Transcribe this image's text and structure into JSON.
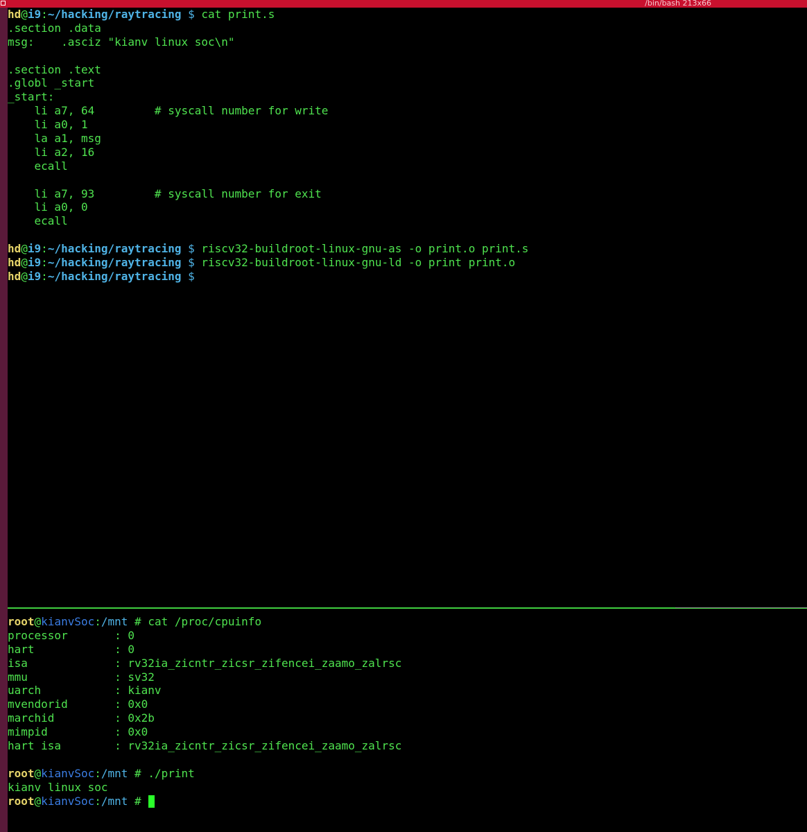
{
  "window": {
    "title": "/bin/bash 213x66",
    "accent": "#c8102e",
    "rail": "#5a1a3a"
  },
  "colors": {
    "text": "#4fe34f",
    "user": "#e6d46a",
    "host": "#4fb3e6",
    "root_host": "#3b7de3",
    "background": "#000000"
  },
  "top_pane": {
    "prompt": {
      "user": "hd",
      "at": "@",
      "host": "i9",
      "sep": ":",
      "path": "~/hacking/raytracing",
      "symbol": " $ "
    },
    "commands": [
      "cat print.s",
      "riscv32-buildroot-linux-gnu-as -o print.o print.s",
      "riscv32-buildroot-linux-gnu-ld -o print print.o",
      ""
    ],
    "file_lines": [
      ".section .data",
      "msg:    .asciz \"kianv linux soc\\n\"",
      "",
      ".section .text",
      ".globl _start",
      "_start:",
      "    li a7, 64         # syscall number for write",
      "    li a0, 1",
      "    la a1, msg",
      "    li a2, 16",
      "    ecall",
      "",
      "    li a7, 93         # syscall number for exit",
      "    li a0, 0",
      "    ecall",
      ""
    ]
  },
  "bottom_pane": {
    "prompt": {
      "user": "root",
      "at": "@",
      "host": "kianvSoc",
      "sep": ":",
      "path": "/mnt",
      "symbol": " # "
    },
    "commands": [
      "cat /proc/cpuinfo",
      "./print",
      ""
    ],
    "cpuinfo_lines": [
      "processor       : 0",
      "hart            : 0",
      "isa             : rv32ia_zicntr_zicsr_zifencei_zaamo_zalrsc",
      "mmu             : sv32",
      "uarch           : kianv",
      "mvendorid       : 0x0",
      "marchid         : 0x2b",
      "mimpid          : 0x0",
      "hart isa        : rv32ia_zicntr_zicsr_zifencei_zaamo_zalrsc",
      ""
    ],
    "program_output": "kianv linux soc"
  }
}
